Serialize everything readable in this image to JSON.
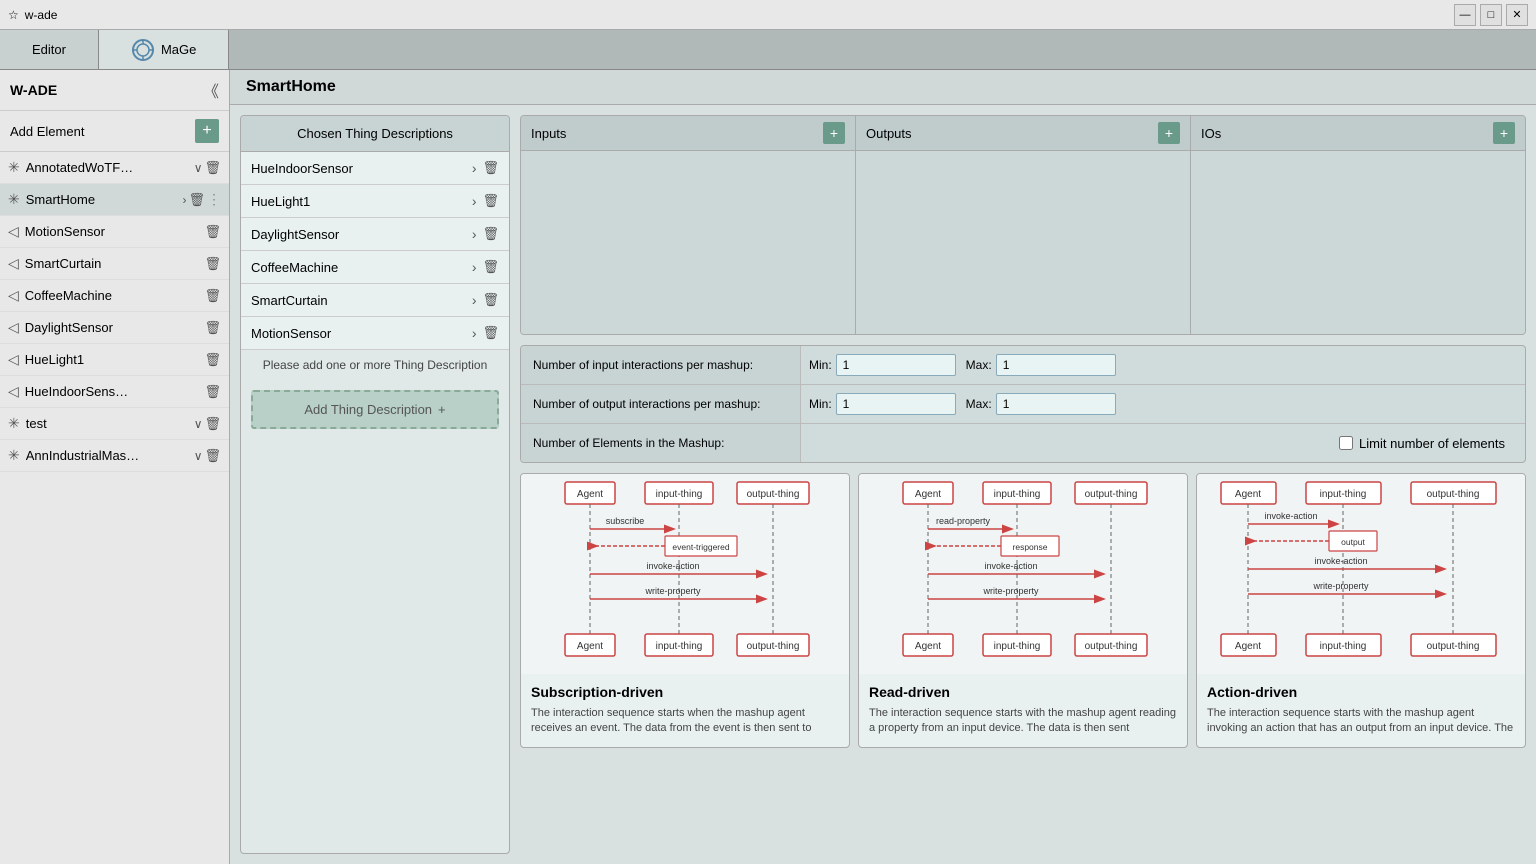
{
  "titleBar": {
    "icon": "☆",
    "title": "w-ade",
    "controls": {
      "minimize": "—",
      "maximize": "□",
      "close": "✕"
    }
  },
  "tabs": [
    {
      "id": "editor",
      "label": "Editor",
      "active": false
    },
    {
      "id": "mage",
      "label": "MaGe",
      "active": true
    }
  ],
  "sidebar": {
    "title": "W-ADE",
    "addElementLabel": "Add Element",
    "items": [
      {
        "id": "annotated",
        "label": "AnnotatedWoTF…",
        "icon": "✳",
        "hasChevron": true,
        "hasExpand": true
      },
      {
        "id": "smarthome",
        "label": "SmartHome",
        "icon": "✳",
        "hasChevron": true,
        "active": true
      },
      {
        "id": "motionsensor",
        "label": "MotionSensor",
        "icon": "◁",
        "hasChevron": false
      },
      {
        "id": "smartcurtain",
        "label": "SmartCurtain",
        "icon": "◁",
        "hasChevron": false
      },
      {
        "id": "coffeemachine",
        "label": "CoffeeMachine",
        "icon": "◁",
        "hasChevron": false
      },
      {
        "id": "daylightsensor",
        "label": "DaylightSensor",
        "icon": "◁",
        "hasChevron": false
      },
      {
        "id": "huelight1",
        "label": "HueLight1",
        "icon": "◁",
        "hasChevron": false
      },
      {
        "id": "hueindisenso",
        "label": "HueIndoorSens…",
        "icon": "◁",
        "hasChevron": false
      },
      {
        "id": "test",
        "label": "test",
        "icon": "✳",
        "hasChevron": true,
        "hasExpand": true
      },
      {
        "id": "annindustrial",
        "label": "AnnIndustrialMas…",
        "icon": "✳",
        "hasChevron": true,
        "hasExpand": true
      }
    ]
  },
  "pageTitle": "SmartHome",
  "thingsPanel": {
    "header": "Chosen Thing Descriptions",
    "items": [
      {
        "label": "HueIndoorSensor"
      },
      {
        "label": "HueLight1"
      },
      {
        "label": "DaylightSensor"
      },
      {
        "label": "CoffeeMachine"
      },
      {
        "label": "SmartCurtain"
      },
      {
        "label": "MotionSensor"
      }
    ],
    "pleaseAddText": "Please add one or more Thing Description",
    "addButton": "Add Thing Description"
  },
  "ioSection": {
    "columns": [
      {
        "id": "inputs",
        "label": "Inputs"
      },
      {
        "id": "outputs",
        "label": "Outputs"
      },
      {
        "id": "ios",
        "label": "IOs"
      }
    ]
  },
  "config": {
    "rows": [
      {
        "label": "Number of input interactions per mashup:",
        "minLabel": "Min:",
        "minValue": "1",
        "maxLabel": "Max:",
        "maxValue": "1"
      },
      {
        "label": "Number of output interactions per mashup:",
        "minLabel": "Min:",
        "minValue": "1",
        "maxLabel": "Max:",
        "maxValue": "1"
      },
      {
        "label": "Number of Elements in the Mashup:",
        "checkboxLabel": "Limit number of elements"
      }
    ]
  },
  "patterns": [
    {
      "id": "subscription",
      "name": "Subscription-driven",
      "description": "The interaction sequence starts when the mashup agent receives an event. The data from the event is then sent to"
    },
    {
      "id": "read",
      "name": "Read-driven",
      "description": "The interaction sequence starts with the mashup agent reading a property from an input device. The data is then sent"
    },
    {
      "id": "action",
      "name": "Action-driven",
      "description": "The interaction sequence starts with the mashup agent invoking an action that has an output from an input device. The"
    }
  ]
}
